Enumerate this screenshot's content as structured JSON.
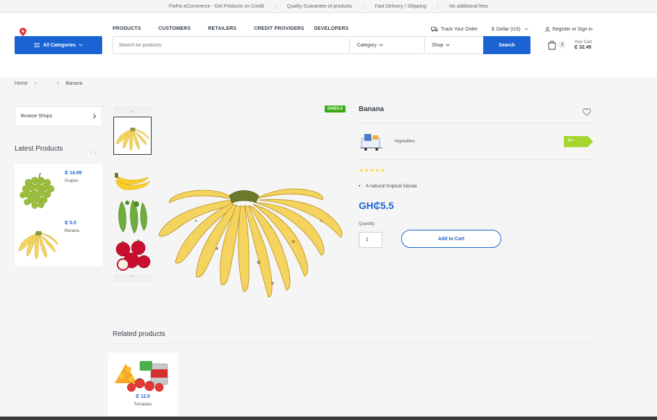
{
  "topbar": {
    "items": [
      "FioFio eCommerce - Get Products on Credit",
      "Quality Guarantee of products",
      "Fast Delivery / Shipping",
      "No additional fees"
    ]
  },
  "nav": {
    "items": [
      "PRODUCTS",
      "CUSTOMERS",
      "RETAILERS",
      "CREDIT PROVIDERS",
      "DEVELOPERS"
    ],
    "track_order": "Track Your Order",
    "currency": "Dollar (US)",
    "currency_symbol": "$",
    "account": "Register or Sign in"
  },
  "search": {
    "all_categories": "All Categories",
    "placeholder": "Search for products",
    "category_select": "Category",
    "shop_select": "Shop",
    "button": "Search"
  },
  "cart": {
    "count": "3",
    "label": "Your Cart",
    "total": "₵ 32.49"
  },
  "breadcrumb": {
    "home": "Home",
    "sep1": "›",
    "sep2": "›",
    "current": "Banana"
  },
  "sidebar": {
    "browse_shops": "Browse Shops",
    "latest_title": "Latest Products",
    "latest_arrows": "‹ ›",
    "latest": [
      {
        "price": "₵ 14.99",
        "name": "Grapes"
      },
      {
        "price": "₵ 5.5",
        "name": "Banana"
      }
    ]
  },
  "product": {
    "sale_tag": "GH₵5.5",
    "name": "Banana",
    "category": "Vegetables",
    "grade": "A+",
    "stars": "★★★★★",
    "rating": 5,
    "bullet_dot": "•",
    "description": "A natural tropical banaa",
    "price": "GH₵5.5",
    "quantity_label": "Quantity:",
    "quantity": "1",
    "add_to_cart": "Add to Cart",
    "thumb_up": "︿",
    "thumb_down": "﹀"
  },
  "related": {
    "title": "Related products",
    "items": [
      {
        "price": "₵ 12.0",
        "name": "Tomatoes"
      }
    ]
  },
  "colors": {
    "primary": "#1b63d3",
    "sale": "#3dab15",
    "grade": "#a6d630",
    "star": "#fdd835"
  }
}
